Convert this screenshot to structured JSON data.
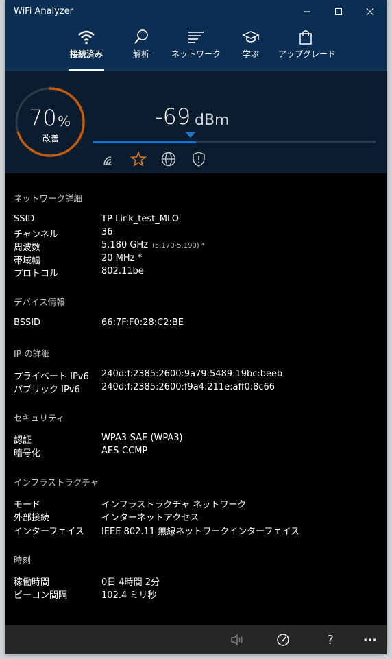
{
  "window": {
    "title": "WiFi Analyzer"
  },
  "nav": {
    "tabs": [
      {
        "label": "接続済み",
        "icon": "wifi-icon",
        "active": true
      },
      {
        "label": "解析",
        "icon": "magnifier-icon",
        "active": false
      },
      {
        "label": "ネットワーク",
        "icon": "network-list-icon",
        "active": false
      },
      {
        "label": "学ぶ",
        "icon": "graduation-cap-icon",
        "active": false
      },
      {
        "label": "アップグレード",
        "icon": "shopping-bag-icon",
        "active": false
      }
    ]
  },
  "signal": {
    "percent": "70",
    "percent_unit": "%",
    "status": "改善",
    "percent_fraction": 0.7,
    "dbm": "-69",
    "dbm_unit": "dBm",
    "accent_orange": "#c45a0e",
    "accent_blue": "#1e74c7",
    "icons": [
      "signal-arcs-icon",
      "star-icon",
      "globe-icon",
      "shield-icon"
    ]
  },
  "details": {
    "network": {
      "title": "ネットワーク詳細",
      "rows": [
        {
          "label": "SSID",
          "value": "TP-Link_test_MLO"
        },
        {
          "label": "チャンネル",
          "value": "36"
        },
        {
          "label": "周波数",
          "value": "5.180 GHz",
          "sub": "(5.170-5.190) *"
        },
        {
          "label": "帯域幅",
          "value": "20 MHz *"
        },
        {
          "label": "プロトコル",
          "value": "802.11be"
        }
      ]
    },
    "device": {
      "title": "デバイス情報",
      "rows": [
        {
          "label": "BSSID",
          "value": "66:7F:F0:28:C2:BE"
        }
      ]
    },
    "ip": {
      "title": "IP の詳細",
      "rows": [
        {
          "label": "プライベート IPv6",
          "value": "240d:f:2385:2600:9a79:5489:19bc:beeb"
        },
        {
          "label": "パブリック IPv6",
          "value": "240d:f:2385:2600:f9a4:211e:aff0:8c66"
        }
      ]
    },
    "security": {
      "title": "セキュリティ",
      "rows": [
        {
          "label": "認証",
          "value": "WPA3-SAE (WPA3)"
        },
        {
          "label": "暗号化",
          "value": "AES-CCMP"
        }
      ]
    },
    "infra": {
      "title": "インフラストラクチャ",
      "rows": [
        {
          "label": "モード",
          "value": "インフラストラクチャ ネットワーク"
        },
        {
          "label": "外部接続",
          "value": "インターネットアクセス"
        },
        {
          "label": "インターフェイス",
          "value": "IEEE 802.11 無線ネットワークインターフェイス"
        }
      ]
    },
    "time": {
      "title": "時刻",
      "rows": [
        {
          "label": "稼働時間",
          "value": "0日 4時間 2分"
        },
        {
          "label": "ビーコン間隔",
          "value": "102.4 ミリ秒"
        }
      ]
    }
  },
  "bottombar": {
    "icons": [
      "speaker-icon",
      "speedometer-icon",
      "help-icon",
      "more-icon"
    ],
    "help_label": "?",
    "more_label": "..."
  }
}
